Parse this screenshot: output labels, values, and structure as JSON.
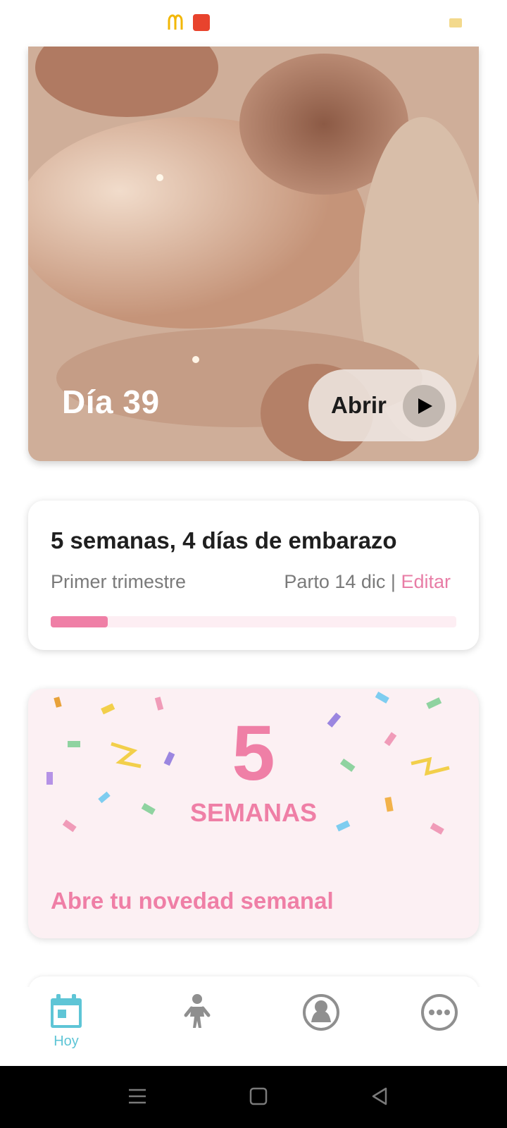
{
  "hero": {
    "day_label": "Día 39",
    "open_label": "Abrir"
  },
  "pregnancy": {
    "title": "5 semanas, 4 días de embarazo",
    "trimester": "Primer trimestre",
    "due_prefix": "Parto 14 dic | ",
    "edit_label": "Editar",
    "progress": 0.14
  },
  "weekly": {
    "number": "5",
    "unit": "SEMANAS",
    "cta": "Abre tu novedad semanal"
  },
  "nav": {
    "today_label": "Hoy"
  },
  "colors": {
    "accent_pink": "#ef7fa6",
    "accent_teal": "#5ec5d6"
  }
}
